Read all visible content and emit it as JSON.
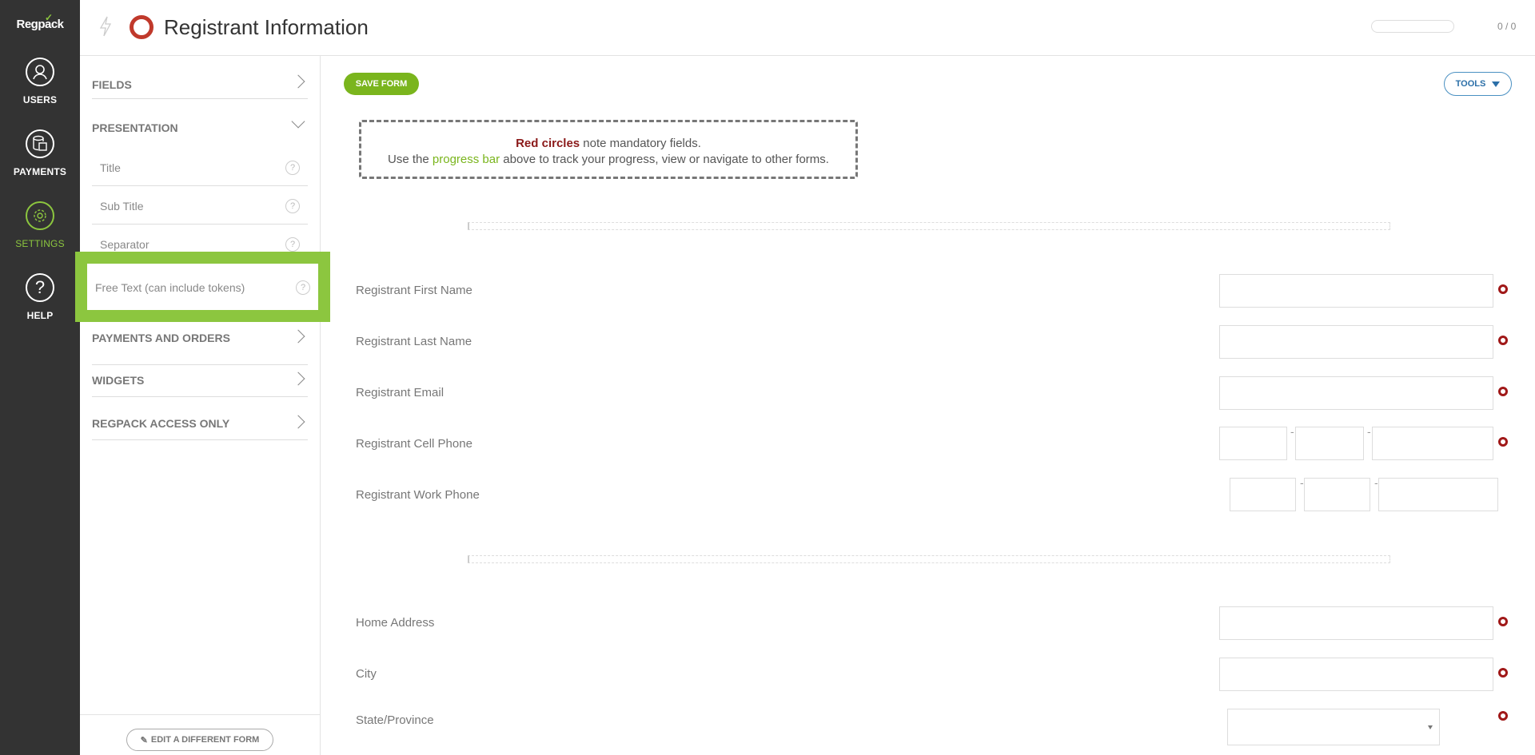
{
  "app": {
    "logo_text": "Regpack",
    "logo_check": "✓"
  },
  "rail": {
    "items": [
      {
        "label": "USERS",
        "icon": "user-icon"
      },
      {
        "label": "PAYMENTS",
        "icon": "payments-icon"
      },
      {
        "label": "SETTINGS",
        "icon": "gear-icon"
      },
      {
        "label": "HELP",
        "icon": "help-icon",
        "glyph": "?"
      }
    ]
  },
  "header": {
    "title": "Registrant Information",
    "progress_value": 0,
    "progress_count": "0 / 0"
  },
  "panel": {
    "sections": [
      {
        "label": "FIELDS"
      },
      {
        "label": "PRESENTATION"
      },
      {
        "label": "PAYMENTS AND ORDERS"
      },
      {
        "label": "WIDGETS"
      },
      {
        "label": "REGPACK ACCESS ONLY"
      }
    ],
    "presentation_items": [
      {
        "label": "Title"
      },
      {
        "label": "Sub Title"
      },
      {
        "label": "Separator"
      },
      {
        "label": "Free Text (can include tokens)"
      }
    ],
    "help_glyph": "?",
    "edit_button": "EDIT A DIFFERENT FORM",
    "edit_icon": "✎"
  },
  "main": {
    "save_button": "SAVE FORM",
    "tools_button": "TOOLS",
    "notice": {
      "red_text": "Red circles",
      "line1_rest": " note mandatory fields.",
      "line2_start": "Use the ",
      "green_text": "progress bar",
      "line2_end": " above to track your progress, view or navigate to other forms."
    },
    "fields": [
      {
        "label": "Registrant First Name"
      },
      {
        "label": "Registrant Last Name"
      },
      {
        "label": "Registrant Email"
      },
      {
        "label": "Registrant Cell Phone"
      },
      {
        "label": "Registrant Work Phone"
      },
      {
        "label": "Home Address"
      },
      {
        "label": "City"
      },
      {
        "label": "State/Province"
      }
    ],
    "phone_separator": "-"
  },
  "colors": {
    "accent": "#8cc63f",
    "required": "#a01818",
    "rail_bg": "#333333",
    "save": "#7ab51d",
    "tools": "#2b6fa8"
  }
}
